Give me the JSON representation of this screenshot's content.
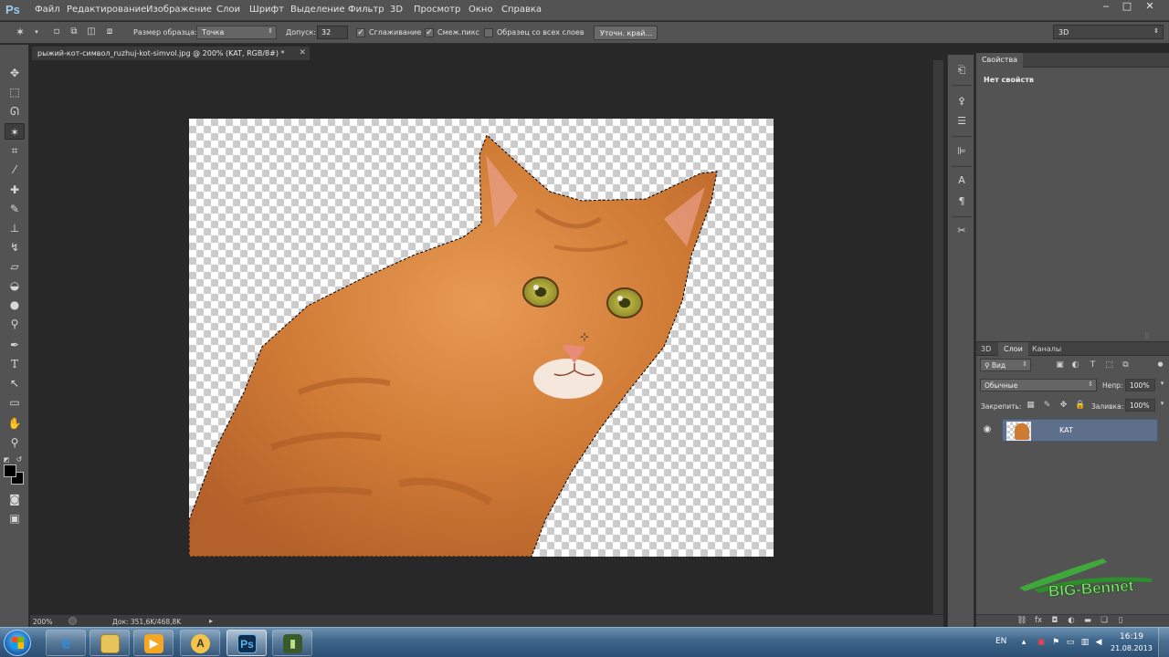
{
  "app": {
    "logo": "Ps"
  },
  "menu": [
    "Файл",
    "Редактирование",
    "Изображение",
    "Слои",
    "Шрифт",
    "Выделение",
    "Фильтр",
    "3D",
    "Просмотр",
    "Окно",
    "Справка"
  ],
  "window_controls": {
    "minimize": "‒",
    "maximize": "□",
    "close": "✕"
  },
  "options": {
    "sample_size_label": "Размер образца:",
    "sample_size_value": "Точка",
    "tolerance_label": "Допуск:",
    "tolerance_value": "32",
    "antialias_label": "Сглаживание",
    "antialias_checked": true,
    "contiguous_label": "Смеж.пикс",
    "contiguous_checked": true,
    "sample_all_label": "Образец со всех слоев",
    "sample_all_checked": false,
    "refine_button": "Уточн. край..."
  },
  "workspace": {
    "value": "3D"
  },
  "document": {
    "tab_title": "рыжий-кот-символ_ruzhuj-kot-simvol.jpg @ 200% (KAT, RGB/8#) *",
    "zoom": "200%",
    "doc_info": "Док: 351,6K/468,8K"
  },
  "properties_panel": {
    "tab": "Свойства",
    "empty_text": "Нет свойств"
  },
  "layers_panel": {
    "tabs": [
      "3D",
      "Слои",
      "Каналы"
    ],
    "active_tab": "Слои",
    "filter_value": "Вид",
    "blend_mode": "Обычные",
    "opacity_label": "Непр:",
    "opacity_value": "100%",
    "lock_label": "Закрепить:",
    "fill_label": "Заливка:",
    "fill_value": "100%",
    "layers": [
      {
        "name": "KAT",
        "visible": true
      }
    ]
  },
  "watermark": {
    "text": "BIG-Bennet"
  },
  "taskbar": {
    "lang": "EN",
    "time": "16:19",
    "date": "21.08.2013",
    "apps": [
      "internet-explorer",
      "explorer",
      "media-player",
      "aimp",
      "photoshop",
      "app"
    ]
  }
}
